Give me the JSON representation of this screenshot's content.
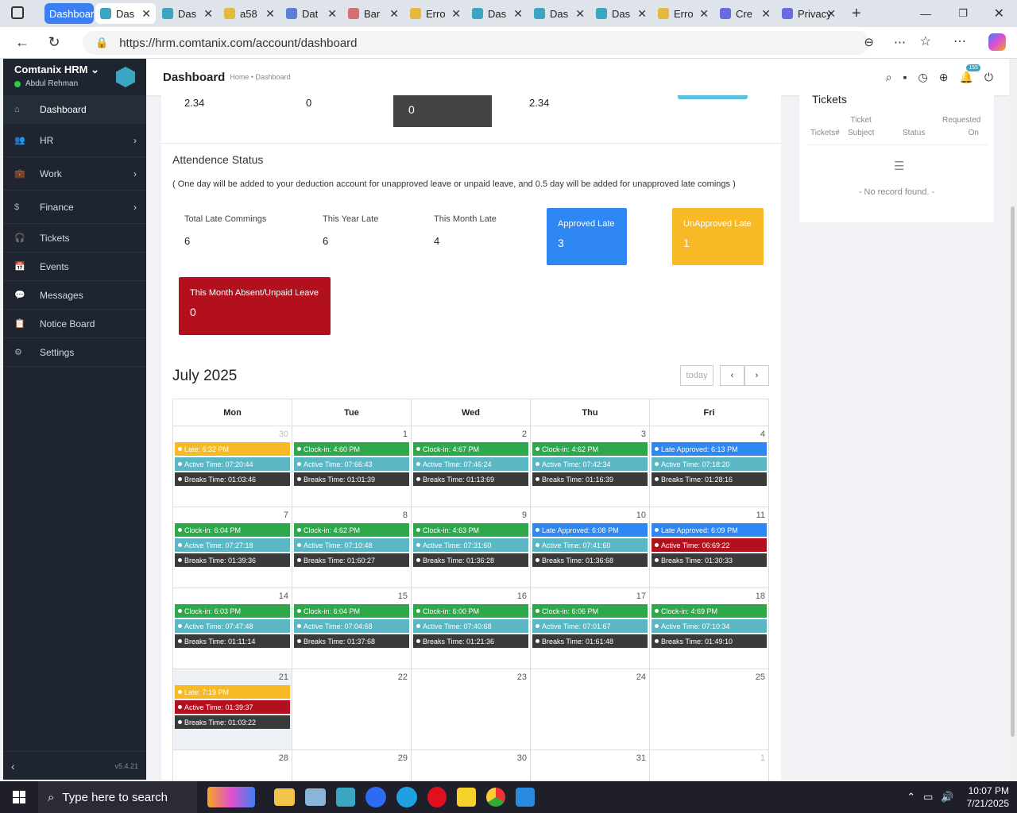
{
  "browser": {
    "tab_group": "Dashboar",
    "tabs": [
      {
        "label": "Das",
        "color": "#3aa6c2",
        "active": true
      },
      {
        "label": "Das",
        "color": "#3aa6c2"
      },
      {
        "label": "a58",
        "color": "#e5b840"
      },
      {
        "label": "Dat",
        "color": "#5b7fd4"
      },
      {
        "label": "Bar",
        "color": "#d47070"
      },
      {
        "label": "Erro",
        "color": "#e5b840"
      },
      {
        "label": "Das",
        "color": "#3aa6c2"
      },
      {
        "label": "Das",
        "color": "#3aa6c2"
      },
      {
        "label": "Das",
        "color": "#3aa6c2"
      },
      {
        "label": "Erro",
        "color": "#e5b840"
      },
      {
        "label": "Cre",
        "color": "#6a6ae0"
      },
      {
        "label": "Privacy",
        "color": "#6a6ae0"
      }
    ],
    "url": "https://hrm.comtanix.com/account/dashboard"
  },
  "sidebar": {
    "brand": "Comtanix HRM",
    "user": "Abdul Rehman",
    "version": "v5.4.21",
    "items": [
      {
        "label": "Dashboard",
        "icon": "⌂",
        "active": true,
        "chevron": false
      },
      {
        "label": "HR",
        "icon": "👥",
        "chevron": true
      },
      {
        "label": "Work",
        "icon": "💼",
        "chevron": true
      },
      {
        "label": "Finance",
        "icon": "$",
        "chevron": true
      },
      {
        "label": "Tickets",
        "icon": "🎧",
        "chevron": false
      },
      {
        "label": "Events",
        "icon": "📅",
        "chevron": false
      },
      {
        "label": "Messages",
        "icon": "💬",
        "chevron": false
      },
      {
        "label": "Notice Board",
        "icon": "📋",
        "chevron": false
      },
      {
        "label": "Settings",
        "icon": "⚙",
        "chevron": false
      }
    ]
  },
  "header": {
    "title": "Dashboard",
    "breadcrumb": "Home • Dashboard",
    "notif_count": "155"
  },
  "top_stats": {
    "a": "2.34",
    "b": "0",
    "c": "0",
    "d": "2.34"
  },
  "attendance": {
    "title": "Attendence Status",
    "note": "( One day will be added to your deduction account for unapproved leave or unpaid leave, and 0.5 day will be added for unapproved late comings )",
    "total_late_label": "Total Late Commings",
    "total_late": "6",
    "year_late_label": "This Year Late",
    "year_late": "6",
    "month_late_label": "This Month Late",
    "month_late": "4",
    "approved_label": "Approved Late",
    "approved": "3",
    "unapproved_label": "UnApproved Late",
    "unapproved": "1",
    "absent_label": "This Month Absent/Unpaid Leave",
    "absent": "0"
  },
  "calendar": {
    "title": "July 2025",
    "today_label": "today",
    "days": [
      "Mon",
      "Tue",
      "Wed",
      "Thu",
      "Fri"
    ],
    "weeks": [
      [
        {
          "n": "30",
          "other": true,
          "ev": [
            [
              "yellow",
              "Late: 6:32 PM"
            ],
            [
              "teal",
              "Active Time: 07:20:44"
            ],
            [
              "dark",
              "Breaks Time: 01:03:46"
            ]
          ]
        },
        {
          "n": "1",
          "ev": [
            [
              "green",
              "Clock-in: 4:60 PM"
            ],
            [
              "teal",
              "Active Time: 07:66:43"
            ],
            [
              "dark",
              "Breaks Time: 01:01:39"
            ]
          ]
        },
        {
          "n": "2",
          "ev": [
            [
              "green",
              "Clock-in: 4:67 PM"
            ],
            [
              "teal",
              "Active Time: 07:46:24"
            ],
            [
              "dark",
              "Breaks Time: 01:13:69"
            ]
          ]
        },
        {
          "n": "3",
          "ev": [
            [
              "green",
              "Clock-in: 4:62 PM"
            ],
            [
              "teal",
              "Active Time: 07:42:34"
            ],
            [
              "dark",
              "Breaks Time: 01:16:39"
            ]
          ]
        },
        {
          "n": "4",
          "ev": [
            [
              "blue",
              "Late Approved: 6:13 PM"
            ],
            [
              "teal",
              "Active Time: 07:18:20"
            ],
            [
              "dark",
              "Breaks Time: 01:28:16"
            ]
          ]
        }
      ],
      [
        {
          "n": "7",
          "ev": [
            [
              "green",
              "Clock-in: 6:04 PM"
            ],
            [
              "teal",
              "Active Time: 07:27:18"
            ],
            [
              "dark",
              "Breaks Time: 01:39:36"
            ]
          ]
        },
        {
          "n": "8",
          "ev": [
            [
              "green",
              "Clock-in: 4:62 PM"
            ],
            [
              "teal",
              "Active Time: 07:10:48"
            ],
            [
              "dark",
              "Breaks Time: 01:60:27"
            ]
          ]
        },
        {
          "n": "9",
          "ev": [
            [
              "green",
              "Clock-in: 4:63 PM"
            ],
            [
              "teal",
              "Active Time: 07:31:60"
            ],
            [
              "dark",
              "Breaks Time: 01:36:28"
            ]
          ]
        },
        {
          "n": "10",
          "ev": [
            [
              "blue",
              "Late Approved: 6:08 PM"
            ],
            [
              "teal",
              "Active Time: 07:41:60"
            ],
            [
              "dark",
              "Breaks Time: 01:36:68"
            ]
          ]
        },
        {
          "n": "11",
          "ev": [
            [
              "blue",
              "Late Approved: 6:09 PM"
            ],
            [
              "red",
              "Active Time: 06:69:22"
            ],
            [
              "dark",
              "Breaks Time: 01:30:33"
            ]
          ]
        }
      ],
      [
        {
          "n": "14",
          "ev": [
            [
              "green",
              "Clock-in: 6:03 PM"
            ],
            [
              "teal",
              "Active Time: 07:47:48"
            ],
            [
              "dark",
              "Breaks Time: 01:11:14"
            ]
          ]
        },
        {
          "n": "15",
          "ev": [
            [
              "green",
              "Clock-in: 6:04 PM"
            ],
            [
              "teal",
              "Active Time: 07:04:68"
            ],
            [
              "dark",
              "Breaks Time: 01:37:68"
            ]
          ]
        },
        {
          "n": "16",
          "ev": [
            [
              "green",
              "Clock-in: 6:00 PM"
            ],
            [
              "teal",
              "Active Time: 07:40:68"
            ],
            [
              "dark",
              "Breaks Time: 01:21:36"
            ]
          ]
        },
        {
          "n": "17",
          "ev": [
            [
              "green",
              "Clock-in: 6:06 PM"
            ],
            [
              "teal",
              "Active Time: 07:01:67"
            ],
            [
              "dark",
              "Breaks Time: 01:61:48"
            ]
          ]
        },
        {
          "n": "18",
          "ev": [
            [
              "green",
              "Clock-in: 4:69 PM"
            ],
            [
              "teal",
              "Active Time: 07:10:34"
            ],
            [
              "dark",
              "Breaks Time: 01:49:10"
            ]
          ]
        }
      ],
      [
        {
          "n": "21",
          "today": true,
          "ev": [
            [
              "yellow",
              "Late: 7:19 PM"
            ],
            [
              "red",
              "Active Time: 01:39:37"
            ],
            [
              "dark",
              "Breaks Time: 01:03:22"
            ]
          ]
        },
        {
          "n": "22",
          "ev": []
        },
        {
          "n": "23",
          "ev": []
        },
        {
          "n": "24",
          "ev": []
        },
        {
          "n": "25",
          "ev": []
        }
      ],
      [
        {
          "n": "28",
          "ev": []
        },
        {
          "n": "29",
          "ev": []
        },
        {
          "n": "30",
          "ev": []
        },
        {
          "n": "31",
          "ev": []
        },
        {
          "n": "1",
          "other": true,
          "ev": []
        }
      ]
    ]
  },
  "tickets": {
    "title": "Tickets",
    "col1": "Tickets#",
    "col2a": "Ticket",
    "col2b": "Subject",
    "col3": "Status",
    "col4a": "Requested",
    "col4b": "On",
    "empty": "- No record found. -"
  },
  "taskbar": {
    "search": "Type here to search",
    "time": "10:07 PM",
    "date": "7/21/2025"
  }
}
